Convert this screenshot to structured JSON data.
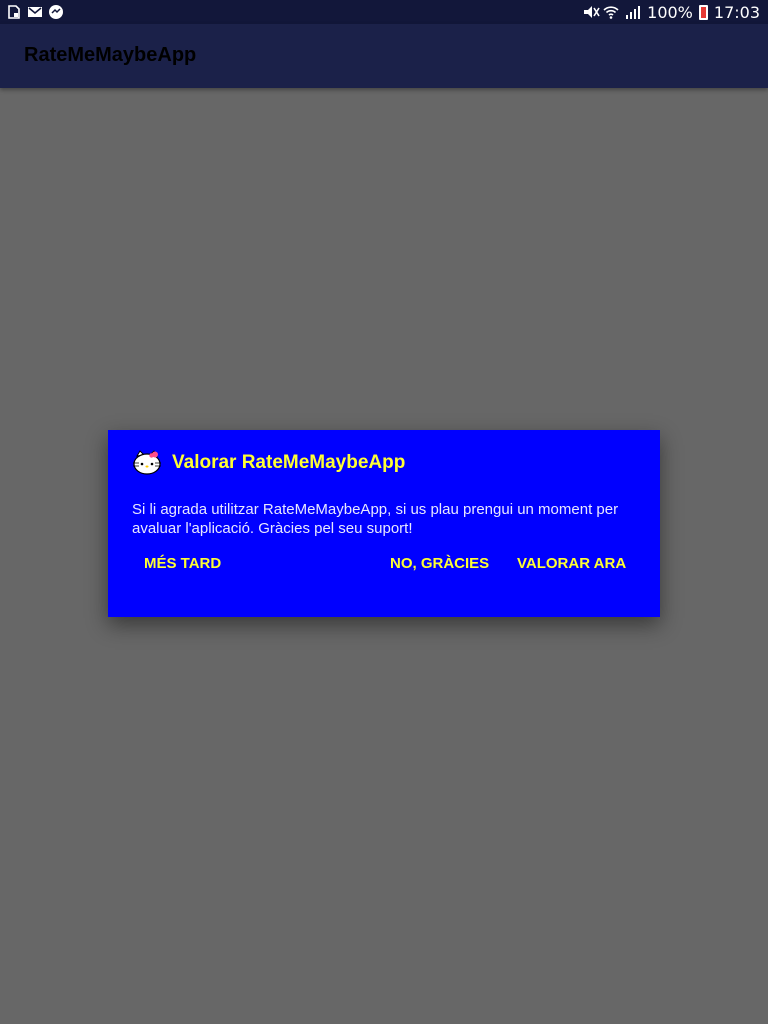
{
  "status_bar": {
    "battery_percent": "100%",
    "time": "17:03",
    "left_icons": [
      "sim-icon",
      "gmail-icon",
      "app-notification-icon"
    ],
    "right_icons": [
      "mute-icon",
      "wifi-icon",
      "signal-icon",
      "battery-charging-icon"
    ]
  },
  "app_bar": {
    "title": "RateMeMaybeApp"
  },
  "dialog": {
    "icon": "hello-kitty-icon",
    "title": "Valorar RateMeMaybeApp",
    "message": "Si li agrada utilitzar RateMeMaybeApp, si us plau prengui un moment per avaluar l'aplicació. Gràcies pel seu suport!",
    "buttons": {
      "later": "MÉS TARD",
      "no_thanks": "NO, GRÀCIES",
      "rate_now": "VALORAR ARA"
    }
  },
  "colors": {
    "dialog_background": "#0000ff",
    "dialog_accent": "#ffff33",
    "app_bar": "#1b2149",
    "status_bar": "#12173a",
    "scrim": "#676767"
  }
}
